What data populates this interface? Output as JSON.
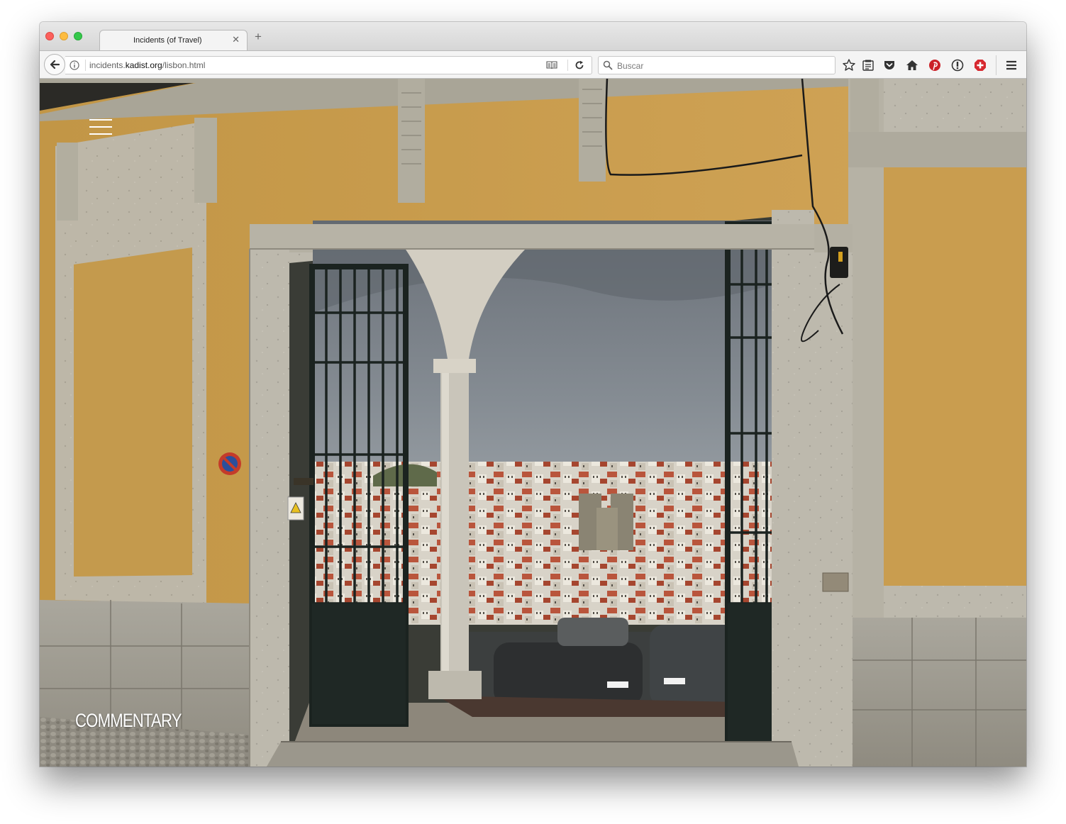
{
  "browser": {
    "tab": {
      "title": "Incidents (of Travel)"
    },
    "url": {
      "prefix": "incidents.",
      "host": "kadist.org",
      "path": "/lisbon.html"
    },
    "search": {
      "placeholder": "Buscar"
    },
    "toolbar_icons": [
      "bookmark-star-icon",
      "reading-list-icon",
      "pocket-icon",
      "home-icon",
      "pinterest-icon",
      "password-manager-icon",
      "adblock-plus-icon",
      "menu-icon"
    ]
  },
  "page": {
    "menu_icon": "hamburger-menu-icon",
    "commentary_link": "COMMENTARY",
    "hero_image": "Gateway with open iron gates and stone column framing a view over Lisbon rooftops and cathedral"
  },
  "colors": {
    "wall_ochre": "#c99d4f",
    "stone": "#b8b4a8",
    "sky": "#8a9199",
    "iron_gate": "#1e2522",
    "pinterest_red": "#cb2027",
    "abp_red": "#d7282f"
  }
}
